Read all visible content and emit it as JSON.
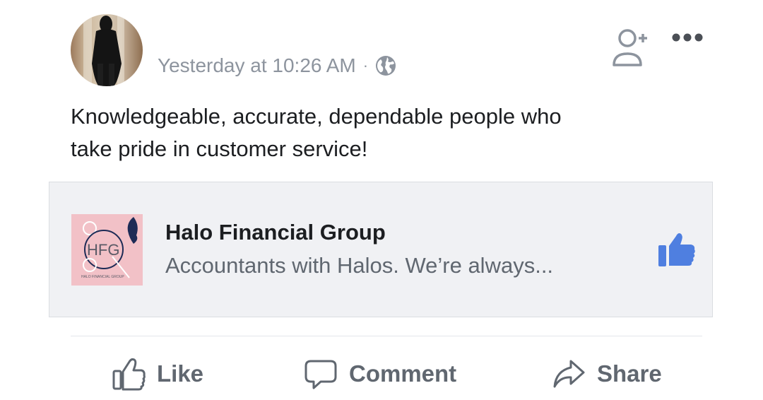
{
  "post": {
    "timestamp": "Yesterday at 10:26 AM",
    "separator": "·",
    "audience_icon": "globe-icon",
    "text_line1": "Knowledgeable, accurate, dependable people who",
    "text_line2": "take pride in customer service!"
  },
  "header_actions": {
    "add_friend_icon": "add-friend-icon",
    "more_icon": "more-options-icon"
  },
  "link_card": {
    "logo_text": "HFG",
    "logo_small_text": "HALO FINANCIAL GROUP",
    "title": "Halo Financial Group",
    "subtitle": "Accountants with Halos. We’re always...",
    "like_icon": "thumbs-up-icon"
  },
  "actions": {
    "like_label": "Like",
    "comment_label": "Comment",
    "share_label": "Share"
  },
  "colors": {
    "text_primary": "#1c1e21",
    "text_secondary": "#606770",
    "meta_gray": "#8d949e",
    "facebook_blue": "#4f7fe0",
    "card_background": "#f0f1f4",
    "logo_pink": "#f2c1c7",
    "logo_navy": "#1d2b56"
  }
}
